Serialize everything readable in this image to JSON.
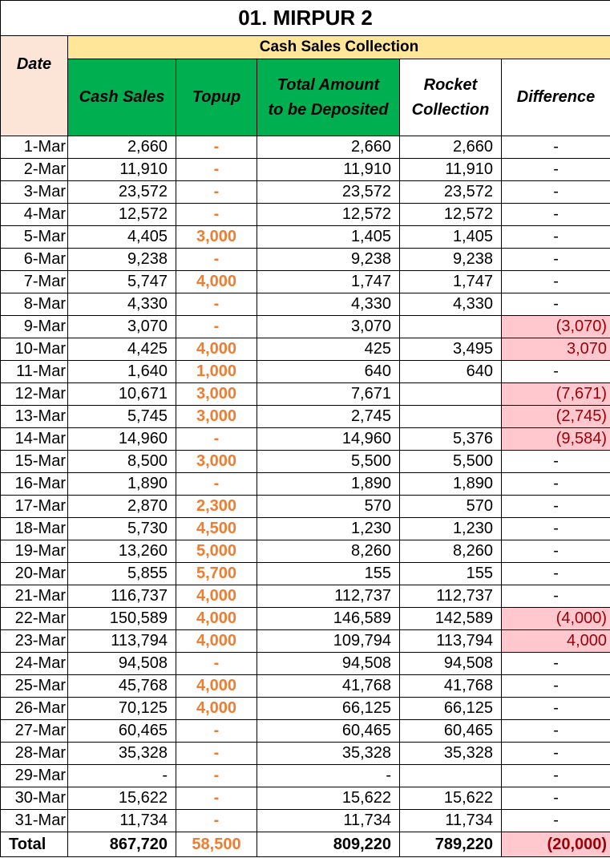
{
  "title": "01. MIRPUR 2",
  "group_header": "Cash Sales Collection",
  "headers": {
    "date": "Date",
    "cash_sales": "Cash Sales",
    "topup": "Topup",
    "total_deposit_line1": "Total Amount",
    "total_deposit_line2": "to be Deposited",
    "rocket_line1": "Rocket",
    "rocket_line2": "Collection",
    "difference": "Difference"
  },
  "colors": {
    "title_bg": "#ffffff",
    "group_header_bg": "#ffe699",
    "date_header_bg": "#fce4d6",
    "green_header_bg": "#00b050",
    "topup_text": "#ed7d31",
    "difference_highlight_bg": "#ffc7ce",
    "difference_highlight_text": "#9c0006"
  },
  "rows": [
    {
      "date": "1-Mar",
      "cash_sales": "2,660",
      "topup": "-",
      "total": "2,660",
      "rocket": "2,660",
      "difference": "-",
      "diff_highlight": false
    },
    {
      "date": "2-Mar",
      "cash_sales": "11,910",
      "topup": "-",
      "total": "11,910",
      "rocket": "11,910",
      "difference": "-",
      "diff_highlight": false
    },
    {
      "date": "3-Mar",
      "cash_sales": "23,572",
      "topup": "-",
      "total": "23,572",
      "rocket": "23,572",
      "difference": "-",
      "diff_highlight": false
    },
    {
      "date": "4-Mar",
      "cash_sales": "12,572",
      "topup": "-",
      "total": "12,572",
      "rocket": "12,572",
      "difference": "-",
      "diff_highlight": false
    },
    {
      "date": "5-Mar",
      "cash_sales": "4,405",
      "topup": "3,000",
      "total": "1,405",
      "rocket": "1,405",
      "difference": "-",
      "diff_highlight": false
    },
    {
      "date": "6-Mar",
      "cash_sales": "9,238",
      "topup": "-",
      "total": "9,238",
      "rocket": "9,238",
      "difference": "-",
      "diff_highlight": false
    },
    {
      "date": "7-Mar",
      "cash_sales": "5,747",
      "topup": "4,000",
      "total": "1,747",
      "rocket": "1,747",
      "difference": "-",
      "diff_highlight": false
    },
    {
      "date": "8-Mar",
      "cash_sales": "4,330",
      "topup": "-",
      "total": "4,330",
      "rocket": "4,330",
      "difference": "-",
      "diff_highlight": false
    },
    {
      "date": "9-Mar",
      "cash_sales": "3,070",
      "topup": "-",
      "total": "3,070",
      "rocket": "",
      "difference": "(3,070)",
      "diff_highlight": true
    },
    {
      "date": "10-Mar",
      "cash_sales": "4,425",
      "topup": "4,000",
      "total": "425",
      "rocket": "3,495",
      "difference": "3,070",
      "diff_highlight": true
    },
    {
      "date": "11-Mar",
      "cash_sales": "1,640",
      "topup": "1,000",
      "total": "640",
      "rocket": "640",
      "difference": "-",
      "diff_highlight": false
    },
    {
      "date": "12-Mar",
      "cash_sales": "10,671",
      "topup": "3,000",
      "total": "7,671",
      "rocket": "",
      "difference": "(7,671)",
      "diff_highlight": true
    },
    {
      "date": "13-Mar",
      "cash_sales": "5,745",
      "topup": "3,000",
      "total": "2,745",
      "rocket": "",
      "difference": "(2,745)",
      "diff_highlight": true
    },
    {
      "date": "14-Mar",
      "cash_sales": "14,960",
      "topup": "-",
      "total": "14,960",
      "rocket": "5,376",
      "difference": "(9,584)",
      "diff_highlight": true
    },
    {
      "date": "15-Mar",
      "cash_sales": "8,500",
      "topup": "3,000",
      "total": "5,500",
      "rocket": "5,500",
      "difference": "-",
      "diff_highlight": false
    },
    {
      "date": "16-Mar",
      "cash_sales": "1,890",
      "topup": "-",
      "total": "1,890",
      "rocket": "1,890",
      "difference": "-",
      "diff_highlight": false
    },
    {
      "date": "17-Mar",
      "cash_sales": "2,870",
      "topup": "2,300",
      "total": "570",
      "rocket": "570",
      "difference": "-",
      "diff_highlight": false
    },
    {
      "date": "18-Mar",
      "cash_sales": "5,730",
      "topup": "4,500",
      "total": "1,230",
      "rocket": "1,230",
      "difference": "-",
      "diff_highlight": false
    },
    {
      "date": "19-Mar",
      "cash_sales": "13,260",
      "topup": "5,000",
      "total": "8,260",
      "rocket": "8,260",
      "difference": "-",
      "diff_highlight": false
    },
    {
      "date": "20-Mar",
      "cash_sales": "5,855",
      "topup": "5,700",
      "total": "155",
      "rocket": "155",
      "difference": "-",
      "diff_highlight": false
    },
    {
      "date": "21-Mar",
      "cash_sales": "116,737",
      "topup": "4,000",
      "total": "112,737",
      "rocket": "112,737",
      "difference": "-",
      "diff_highlight": false
    },
    {
      "date": "22-Mar",
      "cash_sales": "150,589",
      "topup": "4,000",
      "total": "146,589",
      "rocket": "142,589",
      "difference": "(4,000)",
      "diff_highlight": true
    },
    {
      "date": "23-Mar",
      "cash_sales": "113,794",
      "topup": "4,000",
      "total": "109,794",
      "rocket": "113,794",
      "difference": "4,000",
      "diff_highlight": true
    },
    {
      "date": "24-Mar",
      "cash_sales": "94,508",
      "topup": "-",
      "total": "94,508",
      "rocket": "94,508",
      "difference": "-",
      "diff_highlight": false
    },
    {
      "date": "25-Mar",
      "cash_sales": "45,768",
      "topup": "4,000",
      "total": "41,768",
      "rocket": "41,768",
      "difference": "-",
      "diff_highlight": false
    },
    {
      "date": "26-Mar",
      "cash_sales": "70,125",
      "topup": "4,000",
      "total": "66,125",
      "rocket": "66,125",
      "difference": "-",
      "diff_highlight": false
    },
    {
      "date": "27-Mar",
      "cash_sales": "60,465",
      "topup": "-",
      "total": "60,465",
      "rocket": "60,465",
      "difference": "-",
      "diff_highlight": false
    },
    {
      "date": "28-Mar",
      "cash_sales": "35,328",
      "topup": "-",
      "total": "35,328",
      "rocket": "35,328",
      "difference": "-",
      "diff_highlight": false
    },
    {
      "date": "29-Mar",
      "cash_sales": "-",
      "topup": "-",
      "total": "-",
      "rocket": "",
      "difference": "-",
      "diff_highlight": false
    },
    {
      "date": "30-Mar",
      "cash_sales": "15,622",
      "topup": "-",
      "total": "15,622",
      "rocket": "15,622",
      "difference": "-",
      "diff_highlight": false
    },
    {
      "date": "31-Mar",
      "cash_sales": "11,734",
      "topup": "-",
      "total": "11,734",
      "rocket": "11,734",
      "difference": "-",
      "diff_highlight": false
    }
  ],
  "total": {
    "label": "Total",
    "cash_sales": "867,720",
    "topup": "58,500",
    "total": "809,220",
    "rocket": "789,220",
    "difference": "(20,000)"
  }
}
